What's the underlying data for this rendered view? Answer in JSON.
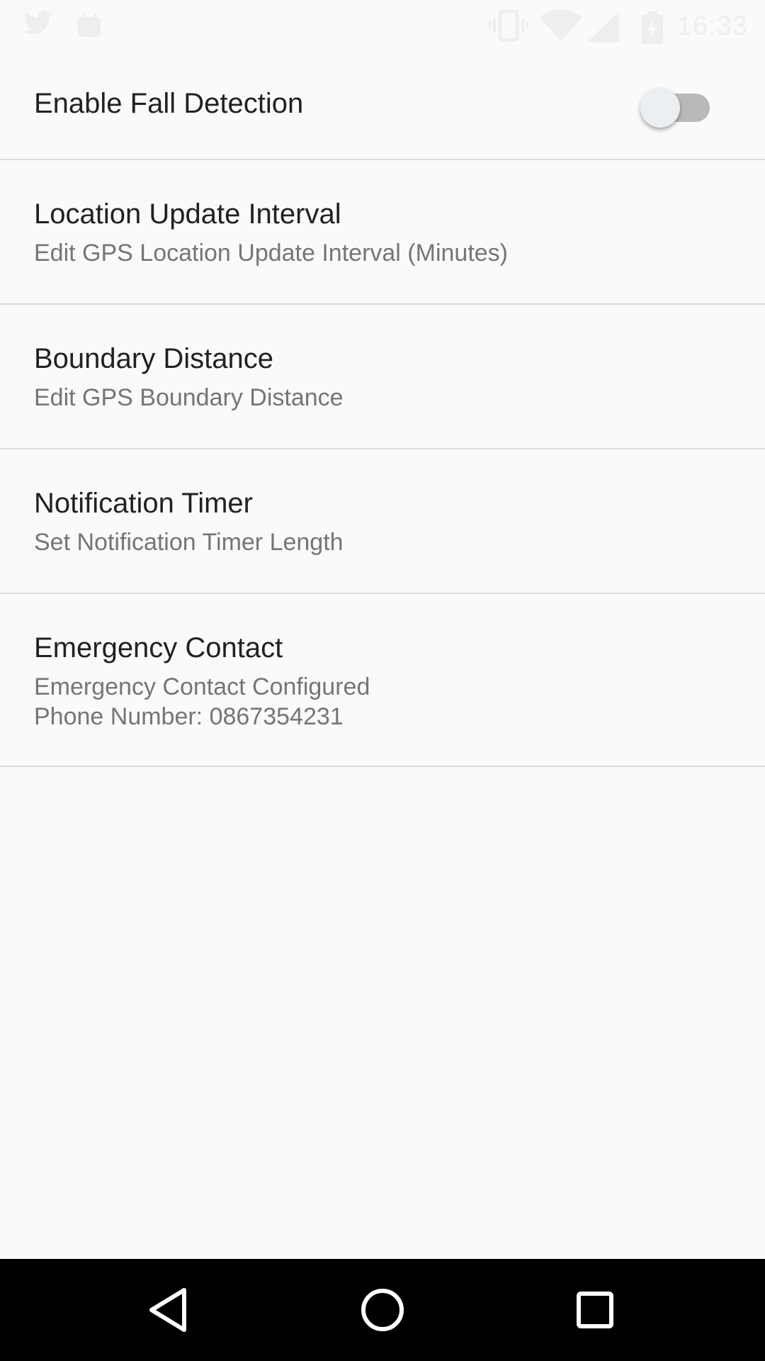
{
  "status_bar": {
    "time": "16:33",
    "icons": [
      "twitter-icon",
      "app-notification-icon",
      "vibrate-icon",
      "wifi-icon",
      "cellular-signal-icon",
      "battery-charging-icon"
    ]
  },
  "settings": {
    "fall_detection": {
      "title": "Enable Fall Detection",
      "enabled": false
    },
    "location_update_interval": {
      "title": "Location Update Interval",
      "summary": "Edit GPS Location Update Interval (Minutes)"
    },
    "boundary_distance": {
      "title": "Boundary Distance",
      "summary": "Edit GPS Boundary Distance"
    },
    "notification_timer": {
      "title": "Notification Timer",
      "summary": "Set Notification Timer Length"
    },
    "emergency_contact": {
      "title": "Emergency Contact",
      "summary_line1": "Emergency Contact Configured",
      "summary_line2": "Phone Number: 0867354231"
    }
  },
  "nav_bar": {
    "icons": [
      "back-icon",
      "home-icon",
      "recents-icon"
    ]
  },
  "colors": {
    "background": "#fafafa",
    "title_text": "#212121",
    "summary_text": "#757575",
    "divider": "#dcdcdc",
    "switch_track_off": "#b9b9b9",
    "switch_thumb_off": "#eceff1",
    "nav_bar": "#000000"
  }
}
